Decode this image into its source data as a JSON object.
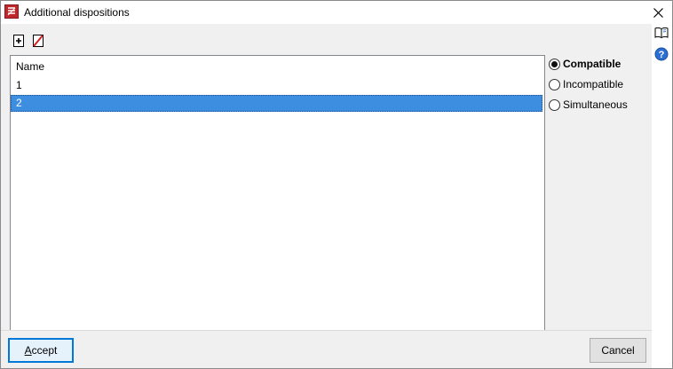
{
  "window": {
    "title": "Additional dispositions"
  },
  "toolbar": {
    "add_icon": "add-icon",
    "delete_icon": "delete-icon"
  },
  "side_icons": {
    "book_icon": "book-icon",
    "help_icon": "help-icon"
  },
  "list": {
    "header": "Name",
    "rows": [
      "1",
      "2"
    ],
    "selected_index": 1
  },
  "radios": [
    {
      "label": "Compatible",
      "checked": true
    },
    {
      "label": "Incompatible",
      "checked": false
    },
    {
      "label": "Simultaneous",
      "checked": false
    }
  ],
  "buttons": {
    "accept_first": "A",
    "accept_rest": "ccept",
    "cancel": "Cancel"
  },
  "colors": {
    "selection": "#3d8ee0",
    "accent": "#0078d7",
    "app_icon": "#c0272d"
  }
}
